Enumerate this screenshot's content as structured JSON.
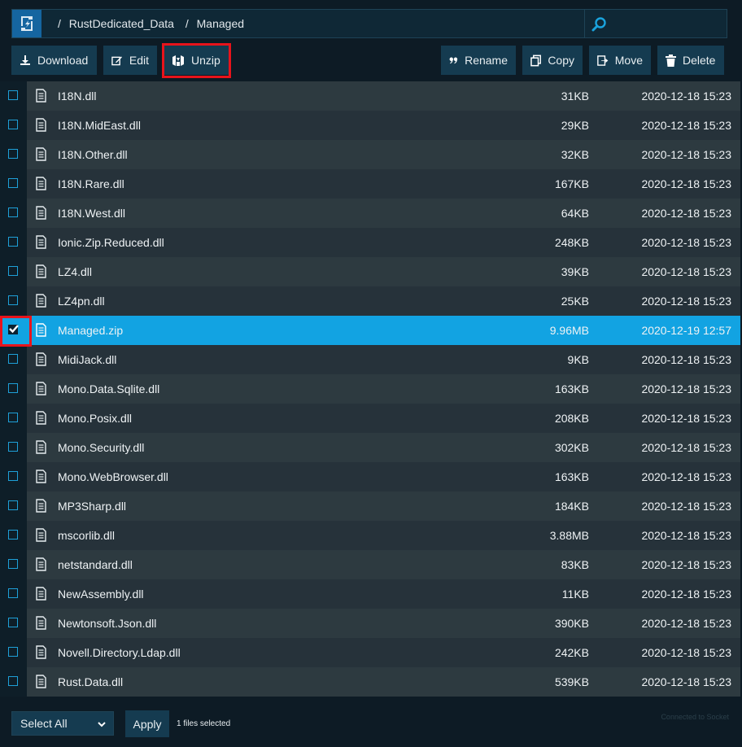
{
  "breadcrumb": {
    "sep1": "/",
    "folder1": "RustDedicated_Data",
    "sep2": "/",
    "folder2": "Managed"
  },
  "toolbar": {
    "download": "Download",
    "edit": "Edit",
    "unzip": "Unzip",
    "rename": "Rename",
    "copy": "Copy",
    "move": "Move",
    "delete": "Delete"
  },
  "files": [
    {
      "name": "I18N.dll",
      "size": "31KB",
      "date": "2020-12-18 15:23",
      "checked": false
    },
    {
      "name": "I18N.MidEast.dll",
      "size": "29KB",
      "date": "2020-12-18 15:23",
      "checked": false
    },
    {
      "name": "I18N.Other.dll",
      "size": "32KB",
      "date": "2020-12-18 15:23",
      "checked": false
    },
    {
      "name": "I18N.Rare.dll",
      "size": "167KB",
      "date": "2020-12-18 15:23",
      "checked": false
    },
    {
      "name": "I18N.West.dll",
      "size": "64KB",
      "date": "2020-12-18 15:23",
      "checked": false
    },
    {
      "name": "Ionic.Zip.Reduced.dll",
      "size": "248KB",
      "date": "2020-12-18 15:23",
      "checked": false
    },
    {
      "name": "LZ4.dll",
      "size": "39KB",
      "date": "2020-12-18 15:23",
      "checked": false
    },
    {
      "name": "LZ4pn.dll",
      "size": "25KB",
      "date": "2020-12-18 15:23",
      "checked": false
    },
    {
      "name": "Managed.zip",
      "size": "9.96MB",
      "date": "2020-12-19 12:57",
      "checked": true
    },
    {
      "name": "MidiJack.dll",
      "size": "9KB",
      "date": "2020-12-18 15:23",
      "checked": false
    },
    {
      "name": "Mono.Data.Sqlite.dll",
      "size": "163KB",
      "date": "2020-12-18 15:23",
      "checked": false
    },
    {
      "name": "Mono.Posix.dll",
      "size": "208KB",
      "date": "2020-12-18 15:23",
      "checked": false
    },
    {
      "name": "Mono.Security.dll",
      "size": "302KB",
      "date": "2020-12-18 15:23",
      "checked": false
    },
    {
      "name": "Mono.WebBrowser.dll",
      "size": "163KB",
      "date": "2020-12-18 15:23",
      "checked": false
    },
    {
      "name": "MP3Sharp.dll",
      "size": "184KB",
      "date": "2020-12-18 15:23",
      "checked": false
    },
    {
      "name": "mscorlib.dll",
      "size": "3.88MB",
      "date": "2020-12-18 15:23",
      "checked": false
    },
    {
      "name": "netstandard.dll",
      "size": "83KB",
      "date": "2020-12-18 15:23",
      "checked": false
    },
    {
      "name": "NewAssembly.dll",
      "size": "11KB",
      "date": "2020-12-18 15:23",
      "checked": false
    },
    {
      "name": "Newtonsoft.Json.dll",
      "size": "390KB",
      "date": "2020-12-18 15:23",
      "checked": false
    },
    {
      "name": "Novell.Directory.Ldap.dll",
      "size": "242KB",
      "date": "2020-12-18 15:23",
      "checked": false
    },
    {
      "name": "Rust.Data.dll",
      "size": "539KB",
      "date": "2020-12-18 15:23",
      "checked": false
    }
  ],
  "footer": {
    "bulk_select": "Select All",
    "apply": "Apply",
    "selected_text": "1 files selected",
    "status": "Connected to Socket"
  },
  "colors": {
    "accent": "#12a3e2",
    "button": "#153b50",
    "highlight": "#e8131b",
    "background": "#0d1b25"
  }
}
